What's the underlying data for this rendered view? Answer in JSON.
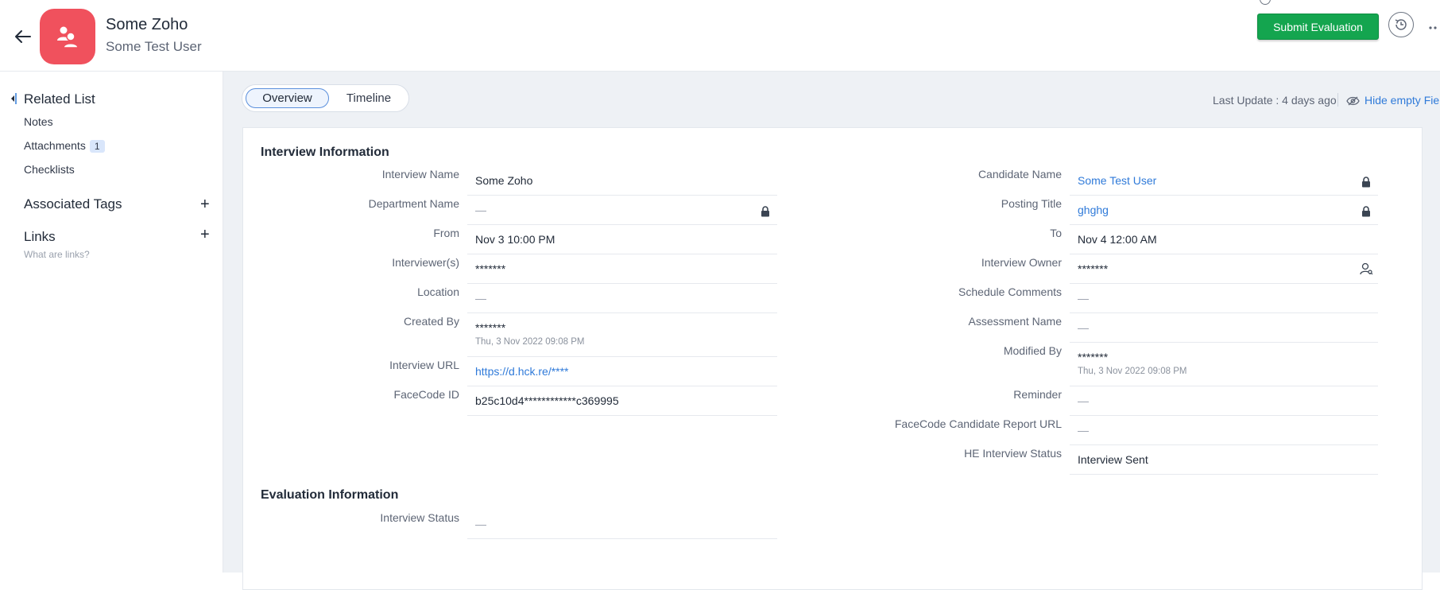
{
  "header": {
    "title": "Some Zoho",
    "subtitle": "Some Test User",
    "submit_label": "Submit Evaluation"
  },
  "sidebar": {
    "title": "Related List",
    "items": [
      {
        "label": "Notes"
      },
      {
        "label": "Attachments",
        "badge": "1"
      },
      {
        "label": "Checklists"
      }
    ],
    "tags_label": "Associated Tags",
    "links_label": "Links",
    "links_hint": "What are links?"
  },
  "tabs": [
    "Overview",
    "Timeline"
  ],
  "last_update": "Last Update : 4 days ago",
  "hide_empty": "Hide empty Fields",
  "interview": {
    "section_title": "Interview Information",
    "left": [
      {
        "label": "Interview Name",
        "value": "Some Zoho"
      },
      {
        "label": "Department Name",
        "value": "—"
      },
      {
        "label": "From",
        "value": "Nov 3 10:00 PM"
      },
      {
        "label": "Interviewer(s)",
        "value": "*******"
      },
      {
        "label": "Location",
        "value": "—"
      },
      {
        "label": "Created By",
        "value": "*******",
        "sub": "Thu, 3 Nov 2022 09:08 PM"
      },
      {
        "label": "Interview URL",
        "value": "https://d.hck.re/****"
      },
      {
        "label": "FaceCode ID",
        "value": "b25c10d4************c369995"
      }
    ],
    "right": [
      {
        "label": "Candidate Name",
        "value": "Some Test User"
      },
      {
        "label": "Posting Title",
        "value": "ghghg"
      },
      {
        "label": "To",
        "value": "Nov 4 12:00 AM"
      },
      {
        "label": "Interview Owner",
        "value": "*******"
      },
      {
        "label": "Schedule Comments",
        "value": "—"
      },
      {
        "label": "Assessment Name",
        "value": "—"
      },
      {
        "label": "Modified By",
        "value": "*******",
        "sub": "Thu, 3 Nov 2022 09:08 PM"
      },
      {
        "label": "Reminder",
        "value": "—"
      },
      {
        "label": "FaceCode Candidate Report URL",
        "value": "—"
      },
      {
        "label": "HE Interview Status",
        "value": "Interview Sent"
      }
    ]
  },
  "evaluation": {
    "section_title": "Evaluation Information",
    "fields": [
      {
        "label": "Interview Status",
        "value": "—"
      }
    ]
  },
  "colors": {
    "accent": "#2f7ad9",
    "submit": "#14a54f",
    "avatar": "#f0515d"
  },
  "icons": [
    "back-arrow-icon",
    "user-group-icon",
    "history-icon",
    "lock-icon",
    "user-search-icon",
    "eye-slash-icon",
    "plus-icon"
  ]
}
